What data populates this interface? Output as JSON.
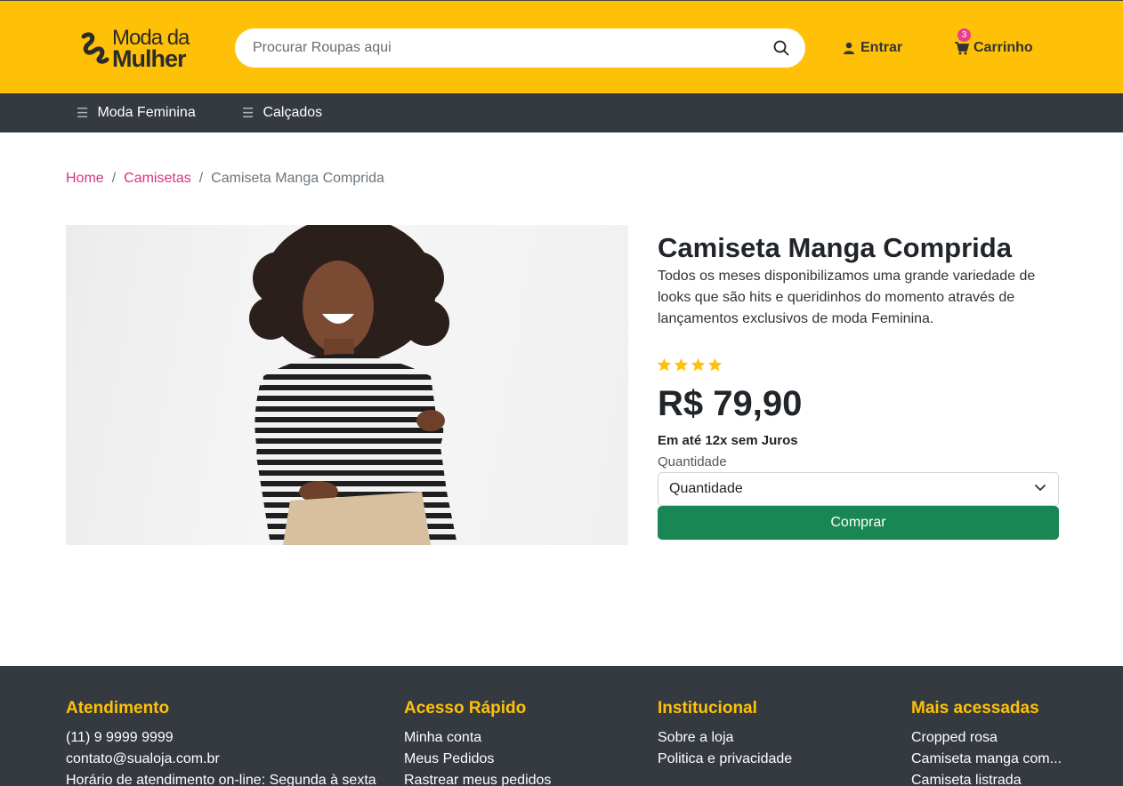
{
  "header": {
    "logo_top": "Moda da",
    "logo_bottom": "Mulher",
    "search_placeholder": "Procurar Roupas aqui",
    "login_label": "Entrar",
    "cart_label": "Carrinho",
    "cart_count": "3"
  },
  "nav": {
    "items": [
      {
        "label": "Moda Feminina"
      },
      {
        "label": "Calçados"
      }
    ]
  },
  "breadcrumb": {
    "home": "Home",
    "category": "Camisetas",
    "current": "Camiseta Manga Comprida"
  },
  "product": {
    "title": "Camiseta Manga Comprida",
    "description": "Todos os meses disponibilizamos uma grande variedade de looks que são hits e queridinhos do momento através de lançamentos exclusivos de moda Feminina.",
    "rating": 4,
    "price": "R$ 79,90",
    "installments": "Em até 12x sem Juros",
    "quantity_label": "Quantidade",
    "quantity_selected": "Quantidade",
    "buy_label": "Comprar"
  },
  "footer": {
    "columns": [
      {
        "title": "Atendimento",
        "links": [
          "(11) 9 9999 9999",
          "contato@sualoja.com.br",
          "Horário de atendimento on-line: Segunda à sexta"
        ]
      },
      {
        "title": "Acesso Rápido",
        "links": [
          "Minha conta",
          "Meus Pedidos",
          "Rastrear meus pedidos"
        ]
      },
      {
        "title": "Institucional",
        "links": [
          "Sobre a loja",
          "Politica e privacidade"
        ]
      },
      {
        "title": "Mais acessadas",
        "links": [
          "Cropped rosa",
          "Camiseta manga com...",
          "Camiseta listrada"
        ]
      }
    ]
  },
  "colors": {
    "header_bg": "#ffc107",
    "nav_bg": "#343a40",
    "link_pink": "#d63384",
    "buy_green": "#198754",
    "footer_title": "#ffc107"
  }
}
